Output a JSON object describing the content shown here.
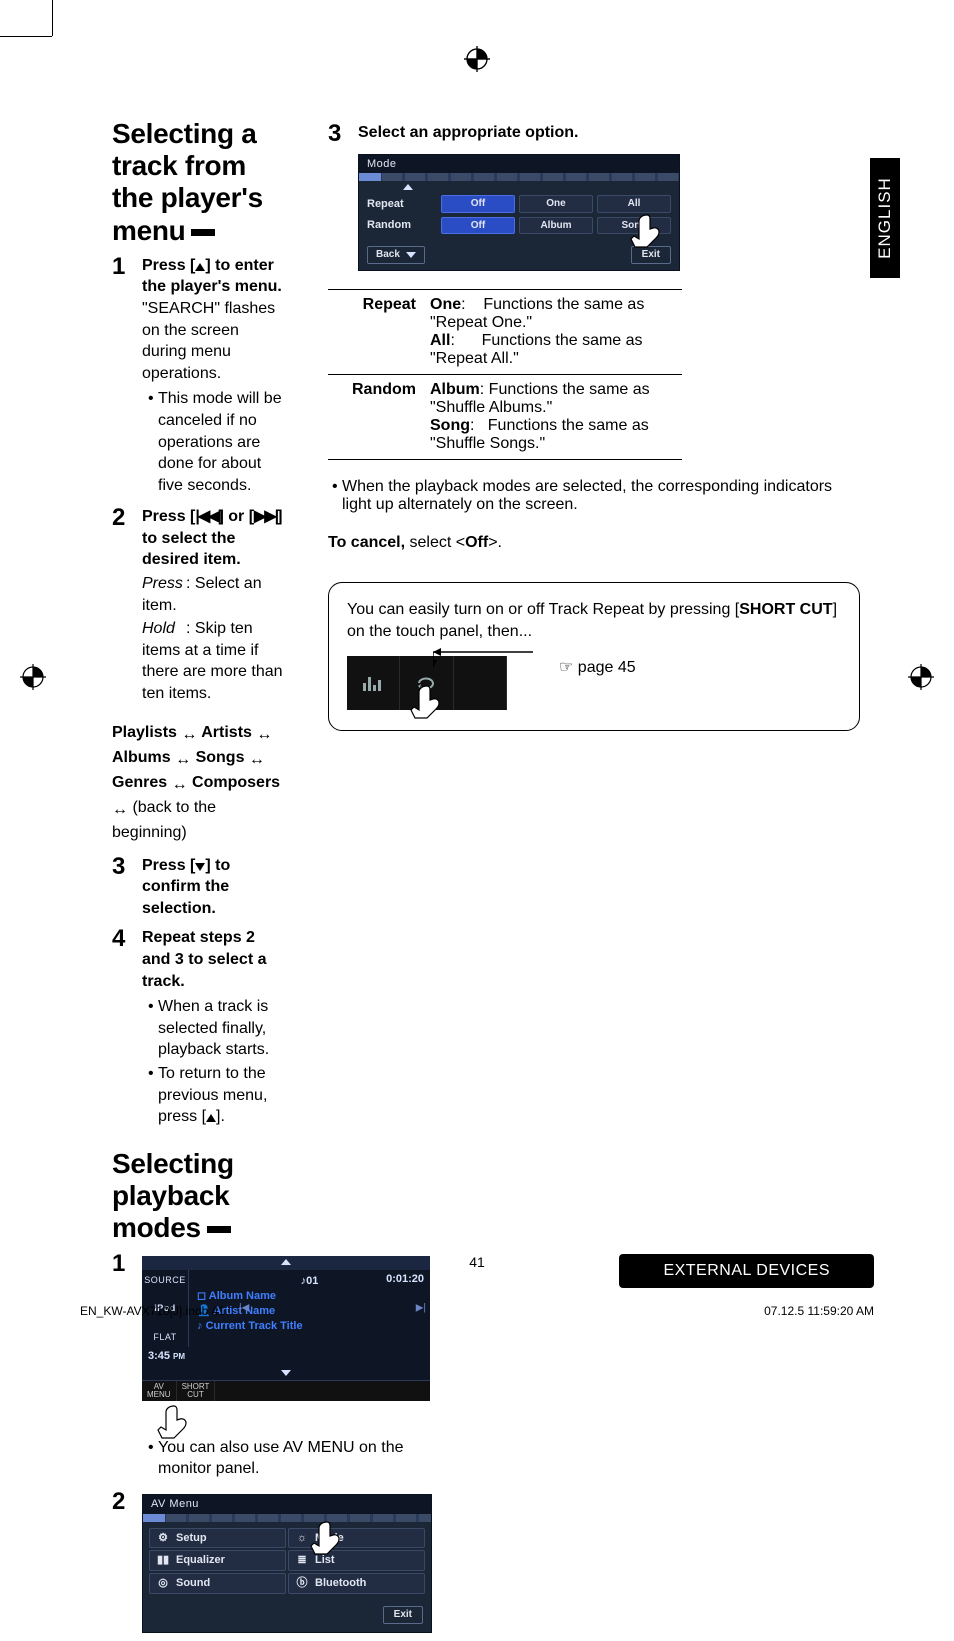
{
  "header": {
    "language_tab": "ENGLISH"
  },
  "section_selecting_track": {
    "title": "Selecting a track from the player's menu",
    "steps": {
      "1": {
        "lead": "Press [▲] to enter the player's menu.",
        "note": "\"SEARCH\" flashes on the screen during menu operations.",
        "bullet": "This mode will be canceled if no operations are done for about five seconds."
      },
      "2": {
        "lead_prefix": "Press [",
        "lead_mid": "] or [",
        "lead_suffix": "] to select the desired item.",
        "press_term": "Press",
        "press_desc": ": Select an item.",
        "hold_term": "Hold",
        "hold_desc": ": Skip ten items at a time if there are more than ten items."
      },
      "nav_sequence": {
        "items": [
          "Playlists",
          "Artists",
          "Albums",
          "Songs",
          "Genres",
          "Composers"
        ],
        "tail": "(back to the beginning)"
      },
      "3": {
        "lead": "Press [▼] to confirm the selection."
      },
      "4": {
        "lead": "Repeat steps 2 and 3 to select a track.",
        "bullets": [
          "When a track is selected finally, playback starts.",
          "To return to the previous menu, press [▲]."
        ]
      }
    }
  },
  "section_playback_modes": {
    "title": "Selecting playback modes",
    "step1": {
      "lcd": {
        "source_label": "SOURCE",
        "ipod_label": "iPod",
        "track_no": "♪01",
        "elapsed": "0:01:20",
        "album_label": "Album Name",
        "artist_label": "Artist Name",
        "track_label": "Current Track Title",
        "flat_label": "FLAT",
        "clock": "3:45",
        "clock_suffix": "PM",
        "soft_av": "AV\nMENU",
        "soft_short": "SHORT\nCUT"
      },
      "bullet": "You can also use AV MENU on the monitor panel."
    },
    "step2": {
      "panel_title": "AV Menu",
      "items": {
        "setup": "Setup",
        "mode": "Mode",
        "equalizer": "Equalizer",
        "list": "List",
        "sound": "Sound",
        "bluetooth": "Bluetooth"
      },
      "exit": "Exit"
    },
    "step3": {
      "lead": "Select an appropriate option.",
      "panel_title": "Mode",
      "rows": {
        "repeat": {
          "label": "Repeat",
          "opts": [
            "Off",
            "One",
            "All"
          ],
          "selected": 0
        },
        "random": {
          "label": "Random",
          "opts": [
            "Off",
            "Album",
            "Song"
          ],
          "selected": 0
        }
      },
      "back": "Back",
      "exit": "Exit"
    },
    "options_table": {
      "repeat": {
        "label": "Repeat",
        "one": {
          "name": "One",
          "desc": "Functions the same as \"Repeat One.\""
        },
        "all": {
          "name": "All",
          "desc": "Functions the same as \"Repeat All.\""
        }
      },
      "random": {
        "label": "Random",
        "album": {
          "name": "Album",
          "desc": "Functions the same as \"Shuffle Albums.\""
        },
        "song": {
          "name": "Song",
          "desc": "Functions the same as \"Shuffle Songs.\""
        }
      }
    },
    "after_table_bullet": "When the playback modes are selected, the corresponding indicators light up alternately on the screen.",
    "cancel_prefix": "To cancel,",
    "cancel_mid": " select <",
    "cancel_value": "Off",
    "cancel_suffix": ">.",
    "callout": {
      "text_prefix": "You can easily turn on or off Track Repeat by pressing [",
      "shortcut": "SHORT CUT",
      "text_suffix": "] on the touch panel, then...",
      "page_ref": "☞ page 45"
    }
  },
  "footer": {
    "page_number": "41",
    "section_chip": "EXTERNAL DEVICES",
    "print_left": "EN_KW-AVX710[J].indb   41",
    "print_right": "07.12.5   11:59:20 AM"
  }
}
